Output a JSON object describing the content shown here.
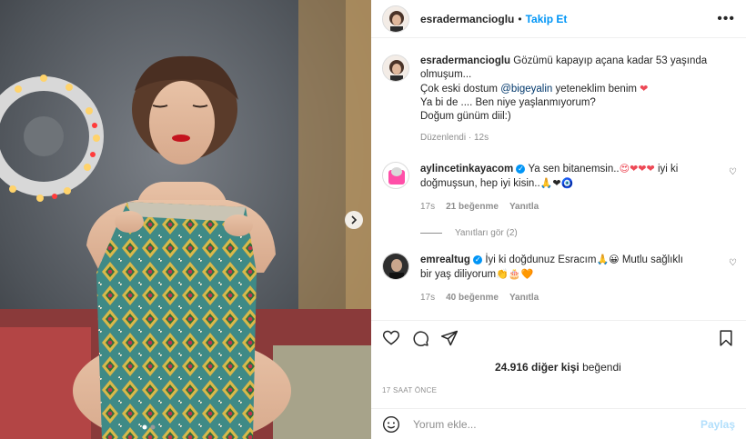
{
  "header": {
    "username": "esradermancioglu",
    "separator": "•",
    "follow_label": "Takip Et",
    "more_label": "•••"
  },
  "caption": {
    "username": "esradermancioglu",
    "line1": "Gözümü kapayıp açana kadar 53 yaşında olmuşum...",
    "line2_pre": "Çok eski dostum ",
    "line2_mention": "@bigeyalin",
    "line2_post": " yeteneklim benim ",
    "line2_emoji": "❤",
    "line3": "Ya bi de .... Ben niye yaşlanmıyorum?",
    "line4": "Doğum günüm diil:)",
    "edited": "Düzenlendi",
    "edited_dot": "·",
    "time": "12s"
  },
  "comments": [
    {
      "username": "aylincetinkayacom",
      "text_pre": " Ya sen bitanemsin..",
      "emojis1": "😍❤❤❤",
      "text_post": " iyi ki doğmuşsun, hep iyi kisin..",
      "emojis2": "🙏❤🧿",
      "time": "17s",
      "likes": "21 beğenme",
      "reply": "Yanıtla"
    },
    {
      "username": "emrealtug",
      "text_pre": " İyi ki doğdunuz Esracım",
      "emojis1": "🙏😀",
      "text_post": " Mutlu sağlıklı bir yaş diliyorum",
      "emojis2": "👏🎂🧡",
      "time": "17s",
      "likes": "40 beğenme",
      "reply": "Yanıtla"
    }
  ],
  "view_replies": "Yanıtları gör (2)",
  "likes": {
    "count": "24.916",
    "text": " diğer kişi",
    "suffix": " beğendi"
  },
  "timestamp": "17 SAAT ÖNCE",
  "add_comment": {
    "placeholder": "Yorum ekle...",
    "post_label": "Paylaş"
  },
  "icons": {
    "emoji": "smiley-icon",
    "like": "heart-icon",
    "comment": "comment-icon",
    "share": "paper-plane-icon",
    "save": "bookmark-icon",
    "next": "chevron-right-icon"
  }
}
